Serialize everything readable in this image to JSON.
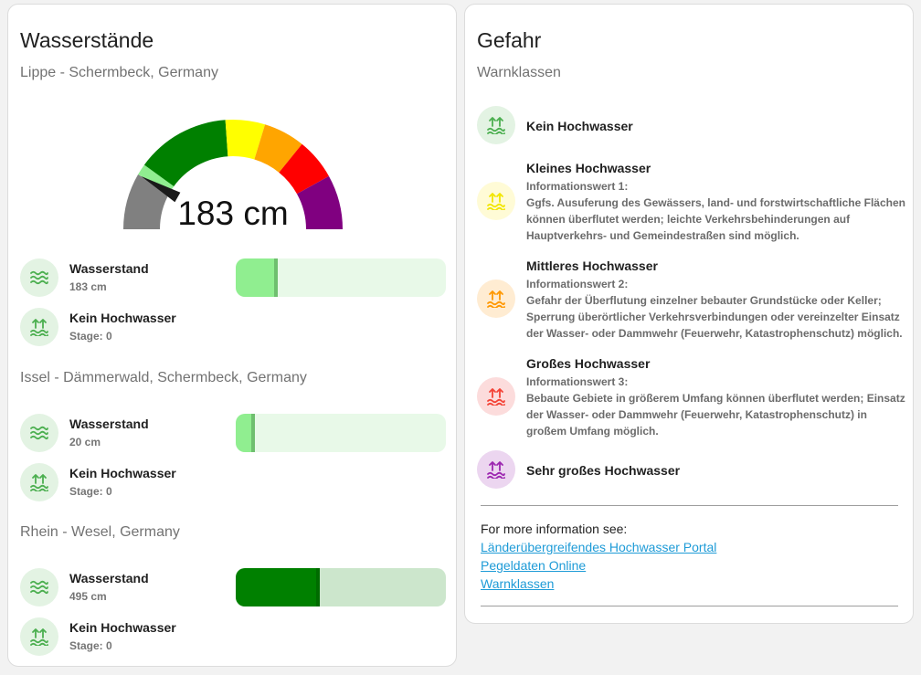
{
  "left_card": {
    "title": "Wasserstände",
    "station1": "Lippe - Schermbeck, Germany",
    "gauge": {
      "value_text": "183 cm",
      "value": 183,
      "segment_colors": [
        "#808080",
        "#90ee90",
        "#008000",
        "#ffff00",
        "#ffa500",
        "#ff0000",
        "#800080"
      ],
      "needle_color": "#1a1a1a"
    },
    "stations": [
      {
        "name": "Lippe - Schermbeck, Germany",
        "level_label": "Wasserstand",
        "level_value": "183 cm",
        "stage_label": "Kein Hochwasser",
        "stage_value": "Stage: 0",
        "bar_fill_fraction": 0.2,
        "bar_colors": {
          "track": "#e8f9e8",
          "fill": "#90ee90",
          "marker": "#6fbf6f"
        }
      },
      {
        "name": "Issel - Dämmerwald, Schermbeck, Germany",
        "level_label": "Wasserstand",
        "level_value": "20 cm",
        "stage_label": "Kein Hochwasser",
        "stage_value": "Stage: 0",
        "bar_fill_fraction": 0.09,
        "bar_colors": {
          "track": "#e8f9e8",
          "fill": "#90ee90",
          "marker": "#6fbf6f"
        }
      },
      {
        "name": "Rhein - Wesel, Germany",
        "level_label": "Wasserstand",
        "level_value": "495 cm",
        "stage_label": "Kein Hochwasser",
        "stage_value": "Stage: 0",
        "bar_fill_fraction": 0.4,
        "bar_colors": {
          "track": "#cce6cc",
          "fill": "#008000",
          "marker": "#006b00"
        }
      }
    ]
  },
  "right_card": {
    "title": "Gefahr",
    "subtitle": "Warnklassen",
    "classes": [
      {
        "title": "Kein Hochwasser",
        "color": "#4caf50",
        "bg": "#e3f3e3"
      },
      {
        "title": "Kleines Hochwasser",
        "info_label": "Informationswert 1:",
        "description": "Ggfs. Ausuferung des Gewässers, land- und forstwirtschaftliche Flächen können überflutet werden; leichte Verkehrsbehinderungen auf Hauptverkehrs- und Gemeindestraßen sind möglich.",
        "color": "#f2e600",
        "bg": "#fffbd6"
      },
      {
        "title": "Mittleres Hochwasser",
        "info_label": "Informationswert 2:",
        "description": "Gefahr der Überflutung einzelner bebauter Grundstücke oder Keller; Sperrung überörtlicher Verkehrsverbindungen oder vereinzelter Einsatz der Wasser- oder Dammwehr (Feuerwehr, Katastrophenschutz) möglich.",
        "color": "#ff9800",
        "bg": "#ffecd2"
      },
      {
        "title": "Großes Hochwasser",
        "info_label": "Informationswert 3:",
        "description": "Bebaute Gebiete in größerem Umfang können überflutet werden; Einsatz der Wasser- oder Dammwehr (Feuerwehr, Katastrophenschutz) in großem Umfang möglich.",
        "color": "#f44336",
        "bg": "#fcdcdc"
      },
      {
        "title": "Sehr großes Hochwasser",
        "color": "#9c27b0",
        "bg": "#ecd6f0"
      }
    ],
    "more_info": "For more information see:",
    "links": [
      "Länderübergreifendes Hochwasser Portal",
      "Pegeldaten Online",
      "Warnklassen"
    ]
  }
}
